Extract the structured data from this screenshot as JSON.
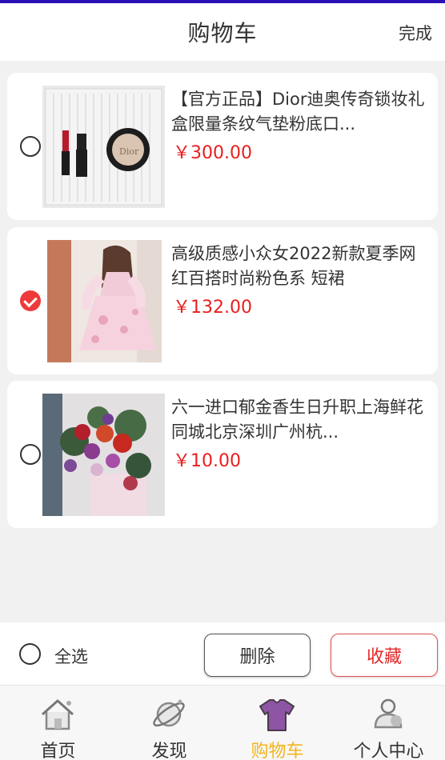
{
  "header": {
    "title": "购物车",
    "done_label": "完成"
  },
  "cart": {
    "items": [
      {
        "title": "【官方正品】Dior迪奥传奇锁妆礼盒限量条纹气垫粉底口...",
        "price": "￥300.00",
        "checked": false,
        "image": "dior-gift-box-image"
      },
      {
        "title": "高级质感小众女2022新款夏季网红百搭时尚粉色系 短裙",
        "price": "￥132.00",
        "checked": true,
        "image": "pink-dress-image"
      },
      {
        "title": "六一进口郁金香生日升职上海鲜花同城北京深圳广州杭...",
        "price": "￥10.00",
        "checked": false,
        "image": "flower-bouquet-image"
      }
    ]
  },
  "bottom": {
    "select_all_label": "全选",
    "delete_label": "删除",
    "favorite_label": "收藏"
  },
  "tabbar": {
    "tabs": [
      {
        "label": "首页",
        "icon": "home-icon"
      },
      {
        "label": "发现",
        "icon": "discover-planet-icon"
      },
      {
        "label": "购物车",
        "icon": "cart-shirt-icon",
        "active": true
      },
      {
        "label": "个人中心",
        "icon": "profile-icon"
      }
    ]
  },
  "colors": {
    "price": "#e8201f",
    "checked": "#ee3a3a",
    "active_tab": "#f4b41e",
    "favorite": "#e52828"
  }
}
